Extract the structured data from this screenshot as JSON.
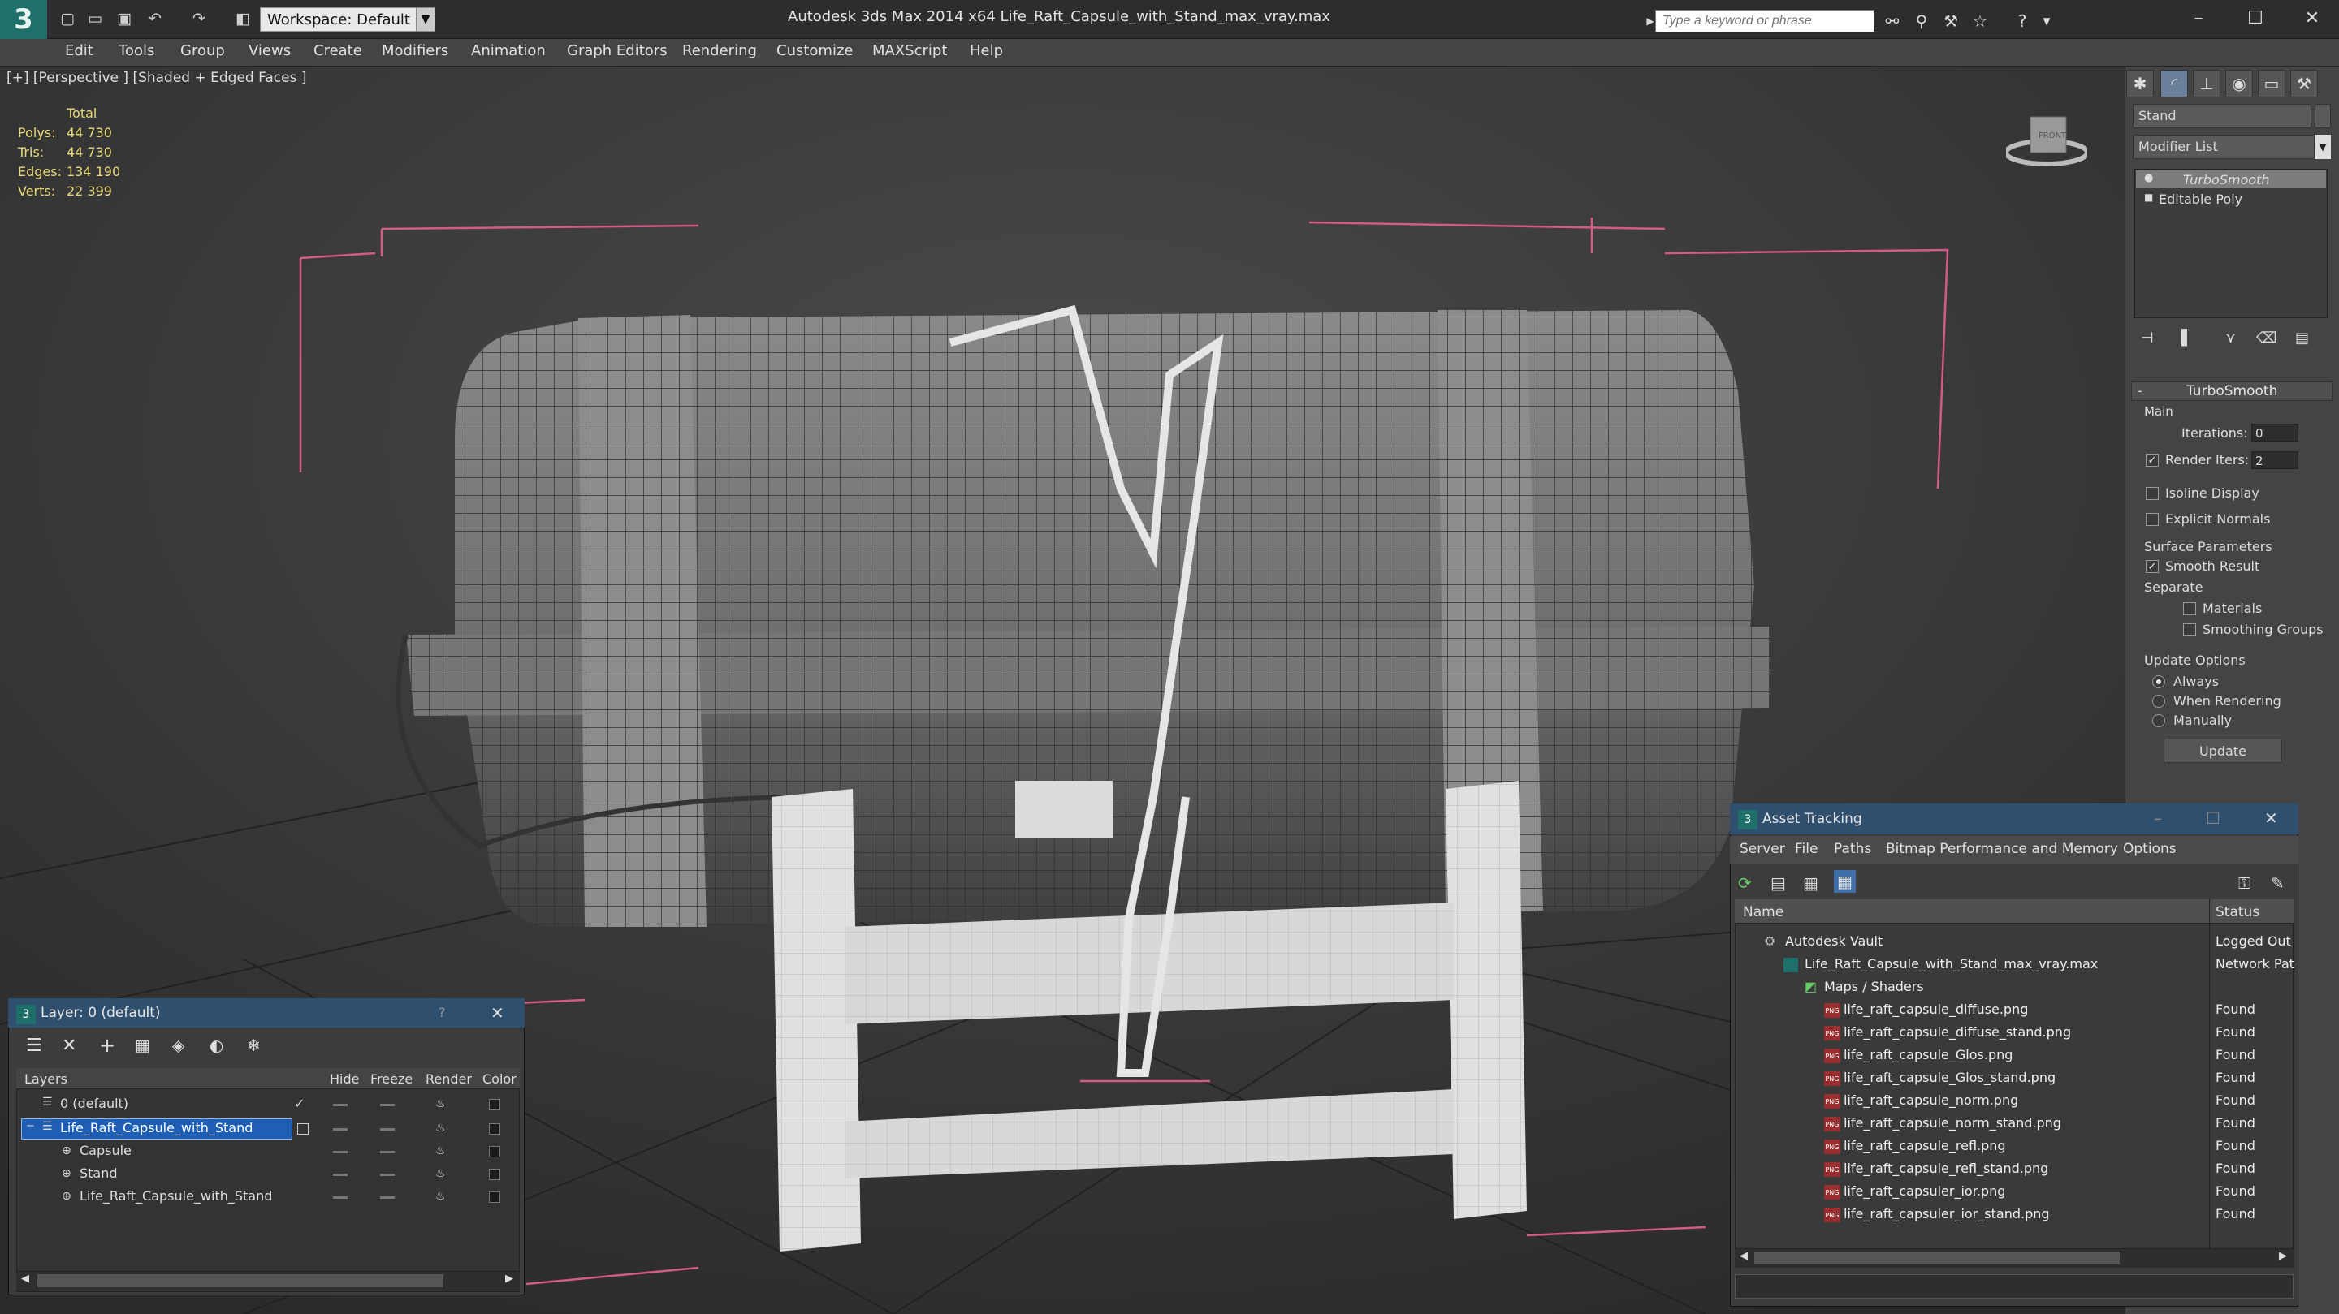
{
  "app": {
    "title": "Autodesk 3ds Max  2014 x64     Life_Raft_Capsule_with_Stand_max_vray.max",
    "workspace": "Workspace: Default",
    "search_placeholder": "Type a keyword or phrase"
  },
  "menu": [
    "Edit",
    "Tools",
    "Group",
    "Views",
    "Create",
    "Modifiers",
    "Animation",
    "Graph Editors",
    "Rendering",
    "Customize",
    "MAXScript",
    "Help"
  ],
  "viewport": {
    "label": "[+] [Perspective ] [Shaded + Edged Faces ]",
    "stats": {
      "header": "Total",
      "labels": [
        "Polys:",
        "Tris:",
        "Edges:",
        "Verts:"
      ],
      "values": [
        "44 730",
        "44 730",
        "134 190",
        "22 399"
      ]
    },
    "viewcube_label": "FRONT"
  },
  "command_panel": {
    "object_name": "Stand",
    "modifier_list": "Modifier List",
    "stack": [
      "TurboSmooth",
      "Editable Poly"
    ],
    "rollout_title": "TurboSmooth",
    "main_label": "Main",
    "iterations_label": "Iterations:",
    "iterations_value": "0",
    "render_iters_label": "Render Iters:",
    "render_iters_value": "2",
    "isoline": "Isoline Display",
    "explicit": "Explicit Normals",
    "surface": "Surface Parameters",
    "smooth": "Smooth Result",
    "separate": "Separate",
    "materials": "Materials",
    "smoothing": "Smoothing Groups",
    "update_options": "Update Options",
    "always": "Always",
    "when_rendering": "When Rendering",
    "manually": "Manually",
    "update_btn": "Update"
  },
  "layer_window": {
    "title": "Layer: 0 (default)",
    "columns": [
      "Layers",
      "Hide",
      "Freeze",
      "Render",
      "Color"
    ],
    "rows": [
      "0 (default)",
      "Life_Raft_Capsule_with_Stand",
      "Capsule",
      "Stand",
      "Life_Raft_Capsule_with_Stand"
    ]
  },
  "asset_window": {
    "title": "Asset Tracking",
    "menu": [
      "Server",
      "File",
      "Paths",
      "Bitmap Performance and Memory",
      "Options"
    ],
    "columns": [
      "Name",
      "Status"
    ],
    "rows": [
      {
        "name": "Autodesk Vault",
        "status": "Logged Out"
      },
      {
        "name": "Life_Raft_Capsule_with_Stand_max_vray.max",
        "status": "Network Pat"
      },
      {
        "name": "Maps / Shaders",
        "status": ""
      },
      {
        "name": "life_raft_capsule_diffuse.png",
        "status": "Found"
      },
      {
        "name": "life_raft_capsule_diffuse_stand.png",
        "status": "Found"
      },
      {
        "name": "life_raft_capsule_Glos.png",
        "status": "Found"
      },
      {
        "name": "life_raft_capsule_Glos_stand.png",
        "status": "Found"
      },
      {
        "name": "life_raft_capsule_norm.png",
        "status": "Found"
      },
      {
        "name": "life_raft_capsule_norm_stand.png",
        "status": "Found"
      },
      {
        "name": "life_raft_capsule_refl.png",
        "status": "Found"
      },
      {
        "name": "life_raft_capsule_refl_stand.png",
        "status": "Found"
      },
      {
        "name": "life_raft_capsuler_ior.png",
        "status": "Found"
      },
      {
        "name": "life_raft_capsuler_ior_stand.png",
        "status": "Found"
      }
    ]
  }
}
